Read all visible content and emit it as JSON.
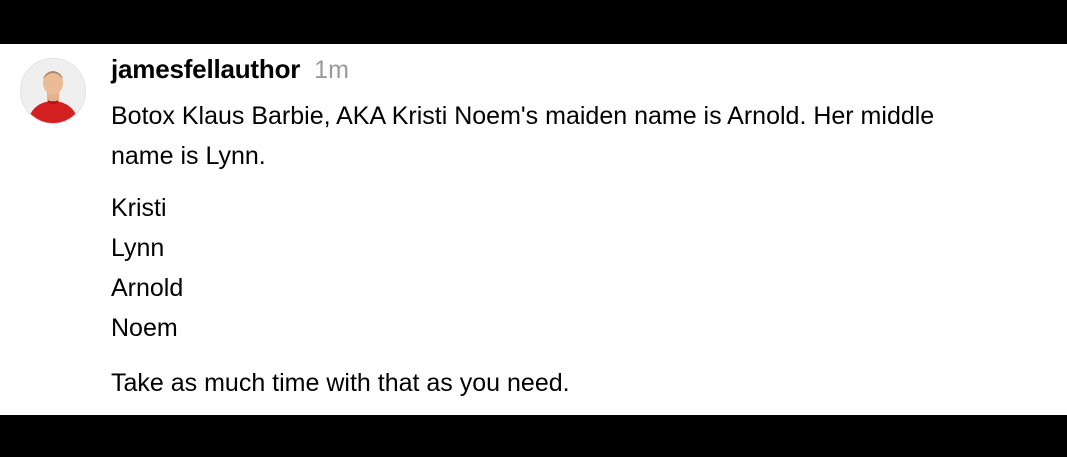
{
  "post": {
    "username": "jamesfellauthor",
    "timestamp": "1m",
    "text_line_1": "Botox Klaus Barbie, AKA Kristi Noem's maiden name is Arnold. Her middle",
    "text_line_2": "name is Lynn.",
    "names": [
      "Kristi",
      "Lynn",
      "Arnold",
      "Noem"
    ],
    "closing": "Take as much time with that as you need.",
    "avatar_icon": "profile-photo",
    "colors": {
      "background": "#ffffff",
      "text": "#000000",
      "timestamp": "#9a9a9a",
      "frame": "#000000",
      "avatar_shirt": "#d31f1f"
    }
  }
}
